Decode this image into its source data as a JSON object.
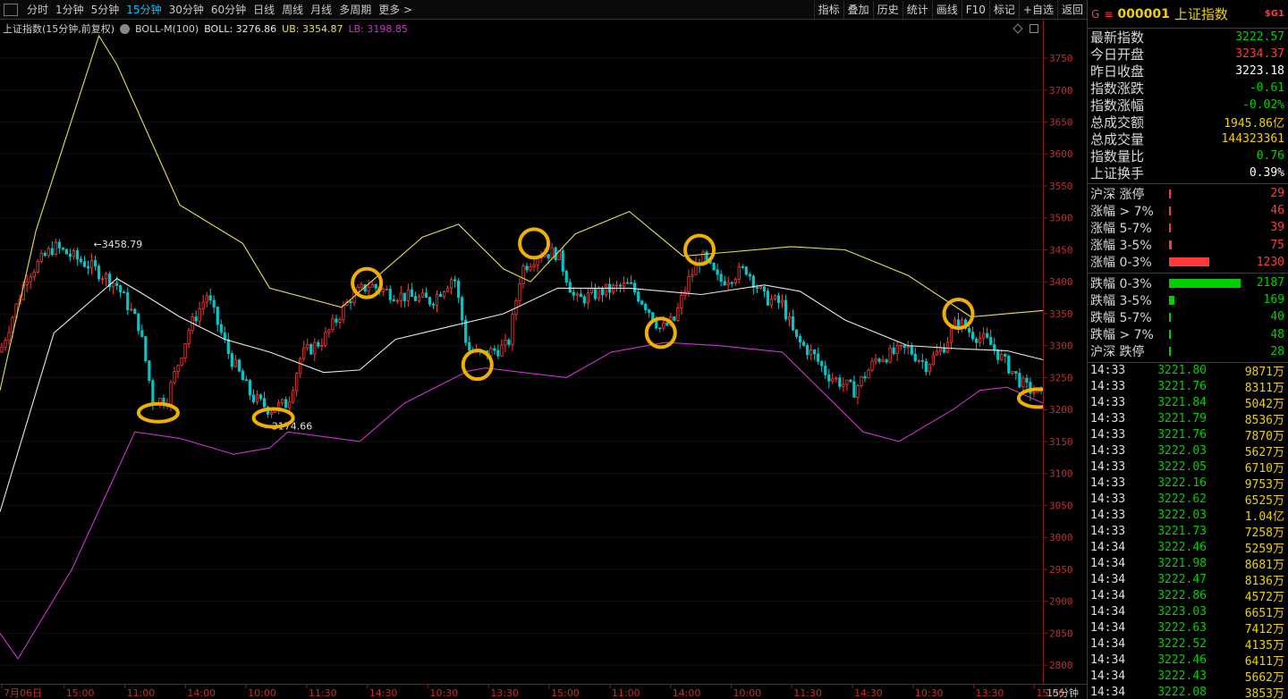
{
  "toolbar": {
    "periods": [
      "分时",
      "1分钟",
      "5分钟",
      "15分钟",
      "30分钟",
      "60分钟",
      "日线",
      "周线",
      "月线",
      "多周期",
      "更多 >"
    ],
    "active_period": "15分钟",
    "tools": [
      "指标",
      "叠加",
      "历史",
      "统计",
      "画线",
      "F10",
      "标记",
      "+自选",
      "返回"
    ]
  },
  "indicator_bar": {
    "title": "上证指数(15分钟,前复权)",
    "indicator": "BOLL-M(100)",
    "boll": "BOLL: 3276.86",
    "ub": "UB: 3354.87",
    "lb": "LB: 3198.85"
  },
  "colors": {
    "up": "#ff3a3a",
    "down": "#00c8c8",
    "upper_band": "#e8e050",
    "mid_band": "#e8e8e8",
    "lower_band": "#d030d0",
    "highlight": "#f0b000",
    "fall_green": "#00d000",
    "volume_yellow": "#f0d000"
  },
  "chart_data": {
    "type": "line",
    "title": "",
    "x_axis_labels": [
      "7月06日",
      "15:00",
      "11:00",
      "14:00",
      "10:00",
      "11:30",
      "14:30",
      "10:30",
      "13:30",
      "15:00",
      "11:00",
      "14:00",
      "10:00",
      "11:30",
      "14:30",
      "10:30",
      "13:30",
      "15:00"
    ],
    "period_label": "15分钟",
    "ylim": [
      2775,
      3785
    ],
    "y_ticks": [
      2800,
      2850,
      2900,
      2950,
      3000,
      3050,
      3100,
      3150,
      3200,
      3250,
      3300,
      3350,
      3400,
      3450,
      3500,
      3550,
      3600,
      3650,
      3700,
      3750
    ],
    "x_count": 1160,
    "series": [
      {
        "name": "UB",
        "points": [
          [
            0,
            3230
          ],
          [
            40,
            3480
          ],
          [
            110,
            3785
          ],
          [
            130,
            3740
          ],
          [
            200,
            3520
          ],
          [
            270,
            3460
          ],
          [
            300,
            3390
          ],
          [
            380,
            3360
          ],
          [
            470,
            3470
          ],
          [
            510,
            3490
          ],
          [
            560,
            3420
          ],
          [
            590,
            3400
          ],
          [
            640,
            3475
          ],
          [
            700,
            3510
          ],
          [
            760,
            3440
          ],
          [
            800,
            3445
          ],
          [
            880,
            3455
          ],
          [
            940,
            3450
          ],
          [
            1010,
            3410
          ],
          [
            1080,
            3345
          ],
          [
            1160,
            3355
          ]
        ]
      },
      {
        "name": "BOLL",
        "points": [
          [
            0,
            3040
          ],
          [
            60,
            3320
          ],
          [
            130,
            3405
          ],
          [
            160,
            3380
          ],
          [
            200,
            3345
          ],
          [
            250,
            3310
          ],
          [
            300,
            3290
          ],
          [
            360,
            3258
          ],
          [
            400,
            3262
          ],
          [
            440,
            3310
          ],
          [
            500,
            3330
          ],
          [
            560,
            3350
          ],
          [
            620,
            3390
          ],
          [
            700,
            3390
          ],
          [
            780,
            3380
          ],
          [
            850,
            3395
          ],
          [
            890,
            3385
          ],
          [
            940,
            3340
          ],
          [
            1010,
            3300
          ],
          [
            1070,
            3295
          ],
          [
            1120,
            3292
          ],
          [
            1160,
            3278
          ]
        ]
      },
      {
        "name": "LB",
        "points": [
          [
            0,
            2850
          ],
          [
            20,
            2810
          ],
          [
            80,
            2950
          ],
          [
            150,
            3165
          ],
          [
            200,
            3155
          ],
          [
            260,
            3130
          ],
          [
            300,
            3140
          ],
          [
            320,
            3165
          ],
          [
            400,
            3150
          ],
          [
            450,
            3210
          ],
          [
            520,
            3260
          ],
          [
            540,
            3265
          ],
          [
            630,
            3250
          ],
          [
            680,
            3290
          ],
          [
            740,
            3305
          ],
          [
            800,
            3300
          ],
          [
            870,
            3290
          ],
          [
            960,
            3165
          ],
          [
            1000,
            3150
          ],
          [
            1060,
            3200
          ],
          [
            1090,
            3230
          ],
          [
            1120,
            3235
          ],
          [
            1160,
            3210
          ]
        ]
      }
    ],
    "price_path": [
      [
        0,
        3290
      ],
      [
        30,
        3410
      ],
      [
        60,
        3455
      ],
      [
        100,
        3425
      ],
      [
        130,
        3395
      ],
      [
        155,
        3330
      ],
      [
        170,
        3215
      ],
      [
        185,
        3215
      ],
      [
        210,
        3325
      ],
      [
        230,
        3380
      ],
      [
        255,
        3285
      ],
      [
        280,
        3220
      ],
      [
        300,
        3200
      ],
      [
        320,
        3210
      ],
      [
        335,
        3285
      ],
      [
        360,
        3310
      ],
      [
        390,
        3375
      ],
      [
        410,
        3395
      ],
      [
        440,
        3380
      ],
      [
        480,
        3370
      ],
      [
        505,
        3410
      ],
      [
        520,
        3295
      ],
      [
        535,
        3285
      ],
      [
        565,
        3300
      ],
      [
        580,
        3420
      ],
      [
        600,
        3445
      ],
      [
        620,
        3445
      ],
      [
        640,
        3370
      ],
      [
        670,
        3385
      ],
      [
        700,
        3395
      ],
      [
        720,
        3360
      ],
      [
        735,
        3325
      ],
      [
        750,
        3340
      ],
      [
        765,
        3400
      ],
      [
        780,
        3440
      ],
      [
        800,
        3400
      ],
      [
        830,
        3420
      ],
      [
        850,
        3375
      ],
      [
        870,
        3365
      ],
      [
        885,
        3310
      ],
      [
        905,
        3285
      ],
      [
        920,
        3255
      ],
      [
        950,
        3230
      ],
      [
        975,
        3280
      ],
      [
        1010,
        3295
      ],
      [
        1030,
        3270
      ],
      [
        1050,
        3300
      ],
      [
        1065,
        3340
      ],
      [
        1080,
        3320
      ],
      [
        1100,
        3305
      ],
      [
        1120,
        3270
      ],
      [
        1140,
        3235
      ],
      [
        1160,
        3222
      ]
    ],
    "annotations": [
      {
        "text": "3458.79",
        "x": 104,
        "y": 3458.79
      },
      {
        "text": "3174.66",
        "x": 293,
        "y": 3174.66
      }
    ],
    "highlight_circles": [
      [
        176,
        3195
      ],
      [
        304,
        3187
      ],
      [
        408,
        3398
      ],
      [
        531,
        3270
      ],
      [
        594,
        3460
      ],
      [
        735,
        3320
      ],
      [
        778,
        3450
      ],
      [
        1066,
        3350
      ],
      [
        1155,
        3218
      ]
    ]
  },
  "quote": {
    "prefix": "G",
    "menu_icon": "menu-icon",
    "code": "000001",
    "name": "上证指数",
    "badge": "$G1",
    "rows": [
      {
        "label": "最新指数",
        "value": "3222.57",
        "color": "#00d000"
      },
      {
        "label": "今日开盘",
        "value": "3234.37",
        "color": "#ff3a3a"
      },
      {
        "label": "昨日收盘",
        "value": "3223.18",
        "color": "#ffffff"
      },
      {
        "label": "指数涨跌",
        "value": "-0.61",
        "color": "#00d000"
      },
      {
        "label": "指数涨幅",
        "value": "-0.02%",
        "color": "#00d000"
      },
      {
        "label": "总成交额",
        "value": "1945.86亿",
        "color": "#f0d000"
      },
      {
        "label": "总成交量",
        "value": "144323361",
        "color": "#f0d000"
      },
      {
        "label": "指数量比",
        "value": "0.76",
        "color": "#00d000"
      },
      {
        "label": "上证换手",
        "value": "0.39%",
        "color": "#ffffff"
      }
    ]
  },
  "breadth_up": [
    {
      "label": "沪深 涨停",
      "count": "29",
      "level": 0.02
    },
    {
      "label": "涨幅 > 7%",
      "count": "46",
      "level": 0.03
    },
    {
      "label": "涨幅 5-7%",
      "count": "39",
      "level": 0.02
    },
    {
      "label": "涨幅 3-5%",
      "count": "75",
      "level": 0.04
    },
    {
      "label": "涨幅 0-3%",
      "count": "1230",
      "level": 0.56
    }
  ],
  "breadth_down": [
    {
      "label": "跌幅 0-3%",
      "count": "2187",
      "level": 1.0
    },
    {
      "label": "跌幅 3-5%",
      "count": "169",
      "level": 0.08
    },
    {
      "label": "跌幅 5-7%",
      "count": "40",
      "level": 0.02
    },
    {
      "label": "跌幅 > 7%",
      "count": "48",
      "level": 0.02
    },
    {
      "label": "沪深 跌停",
      "count": "28",
      "level": 0.01
    }
  ],
  "ticks": [
    {
      "time": "14:33",
      "price": "3221.80",
      "vol": "9871万"
    },
    {
      "time": "14:33",
      "price": "3221.76",
      "vol": "8311万"
    },
    {
      "time": "14:33",
      "price": "3221.84",
      "vol": "5042万"
    },
    {
      "time": "14:33",
      "price": "3221.79",
      "vol": "8536万"
    },
    {
      "time": "14:33",
      "price": "3221.76",
      "vol": "7870万"
    },
    {
      "time": "14:33",
      "price": "3222.03",
      "vol": "5627万"
    },
    {
      "time": "14:33",
      "price": "3222.05",
      "vol": "6710万"
    },
    {
      "time": "14:33",
      "price": "3222.16",
      "vol": "9753万"
    },
    {
      "time": "14:33",
      "price": "3222.62",
      "vol": "6525万"
    },
    {
      "time": "14:33",
      "price": "3222.03",
      "vol": "1.04亿"
    },
    {
      "time": "14:33",
      "price": "3221.73",
      "vol": "7258万"
    },
    {
      "time": "14:34",
      "price": "3222.46",
      "vol": "5259万"
    },
    {
      "time": "14:34",
      "price": "3221.98",
      "vol": "8681万"
    },
    {
      "time": "14:34",
      "price": "3222.47",
      "vol": "8136万"
    },
    {
      "time": "14:34",
      "price": "3222.86",
      "vol": "4572万"
    },
    {
      "time": "14:34",
      "price": "3223.03",
      "vol": "6651万"
    },
    {
      "time": "14:34",
      "price": "3222.63",
      "vol": "7412万"
    },
    {
      "time": "14:34",
      "price": "3222.52",
      "vol": "4135万"
    },
    {
      "time": "14:34",
      "price": "3222.46",
      "vol": "6411万"
    },
    {
      "time": "14:34",
      "price": "3222.43",
      "vol": "5662万"
    },
    {
      "time": "14:34",
      "price": "3222.08",
      "vol": "3853万"
    }
  ]
}
